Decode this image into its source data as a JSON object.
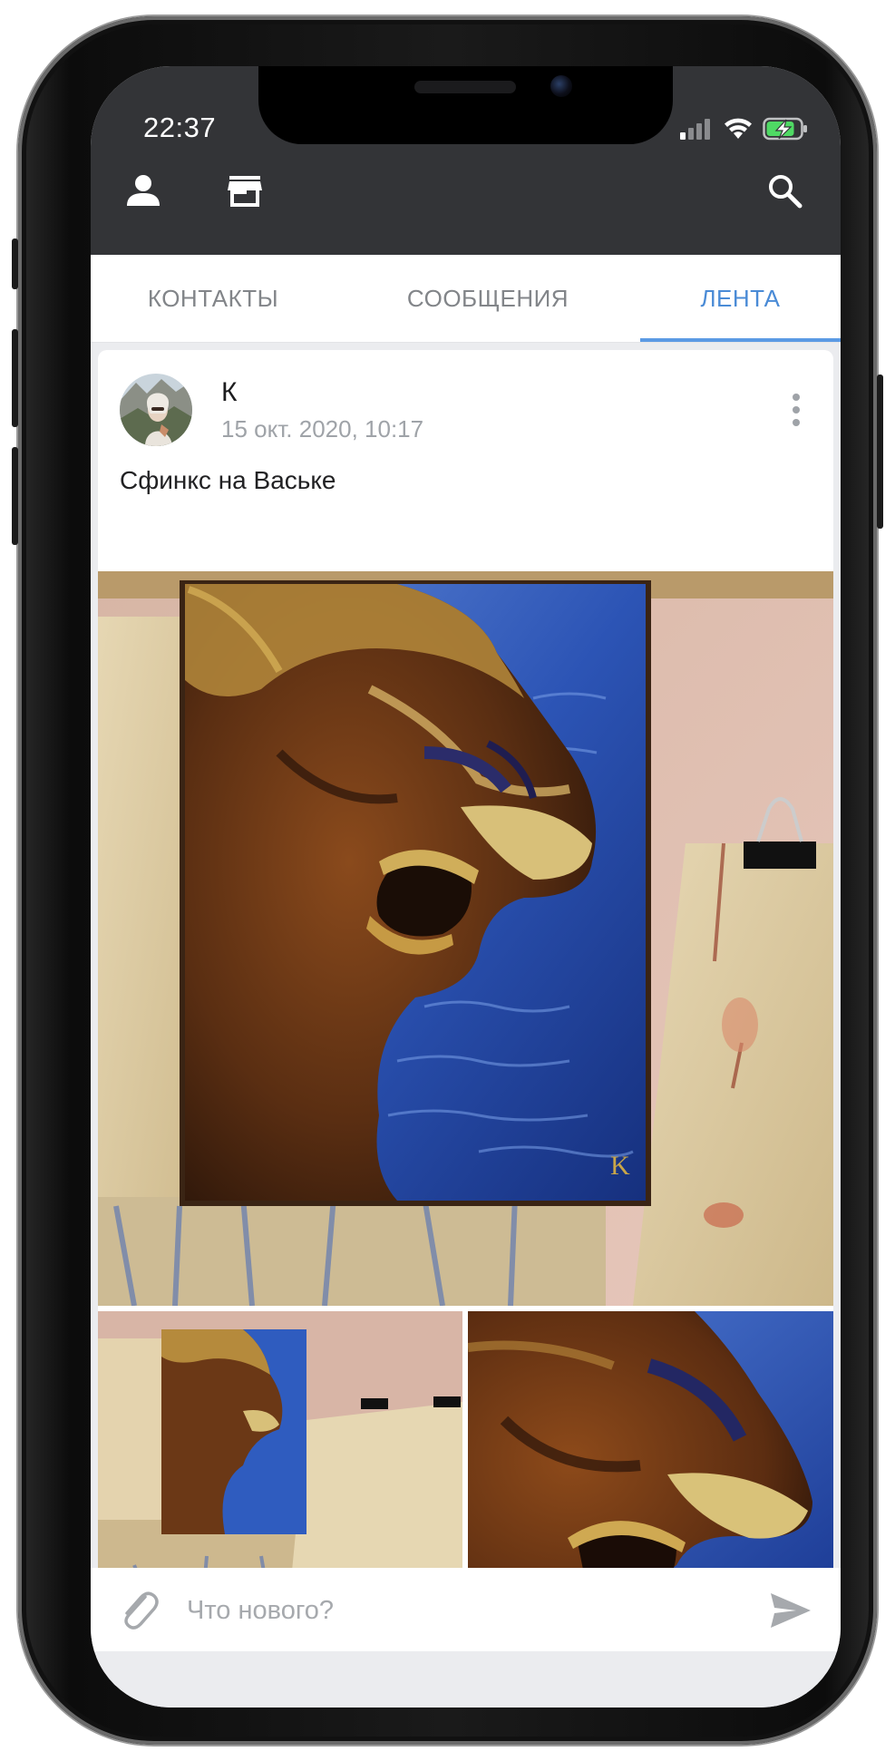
{
  "status_bar": {
    "time": "22:37"
  },
  "header": {
    "icons": [
      "person-icon",
      "store-icon",
      "search-icon"
    ]
  },
  "tabs": [
    {
      "label": "КОНТАКТЫ",
      "active": false
    },
    {
      "label": "СООБЩЕНИЯ",
      "active": false
    },
    {
      "label": "ЛЕНТА",
      "active": true
    }
  ],
  "post": {
    "author": "К",
    "date": "15 окт. 2020, 10:17",
    "text": "Сфинкс на Ваське",
    "photo_count": 3
  },
  "composer": {
    "placeholder": "Что нового?"
  },
  "colors": {
    "header_bg": "#333437",
    "accent": "#4a8bd6",
    "tab_text": "#828589",
    "muted_text": "#9fa3a8",
    "page_bg": "#ebecef"
  }
}
